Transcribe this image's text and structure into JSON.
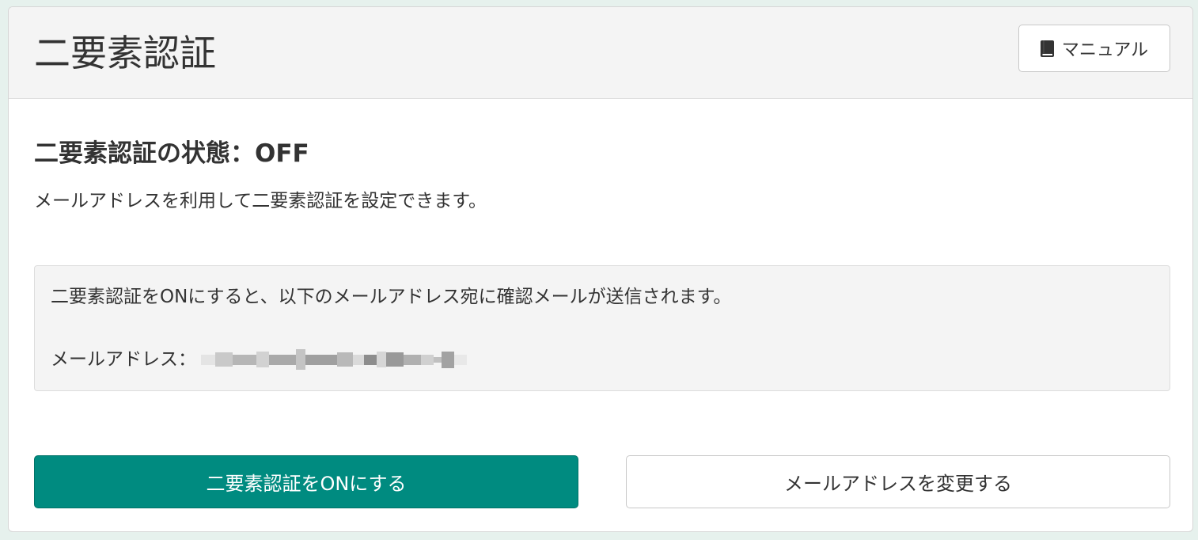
{
  "header": {
    "title": "二要素認証",
    "manual_button_label": "マニュアル",
    "manual_icon": "book-icon"
  },
  "status": {
    "heading": "二要素認証の状態：OFF",
    "description": "メールアドレスを利用して二要素認証を設定できます。"
  },
  "info": {
    "message": "二要素認証をONにすると、以下のメールアドレス宛に確認メールが送信されます。",
    "email_label": "メールアドレス：",
    "email_value_note": "email address is pixelated/blurred in screenshot"
  },
  "actions": {
    "enable_button_label": "二要素認証をONにする",
    "change_email_button_label": "メールアドレスを変更する"
  },
  "colors": {
    "primary": "#008b80",
    "page_background": "#e6f1ed",
    "header_background": "#f4f4f4",
    "text": "#333333"
  }
}
